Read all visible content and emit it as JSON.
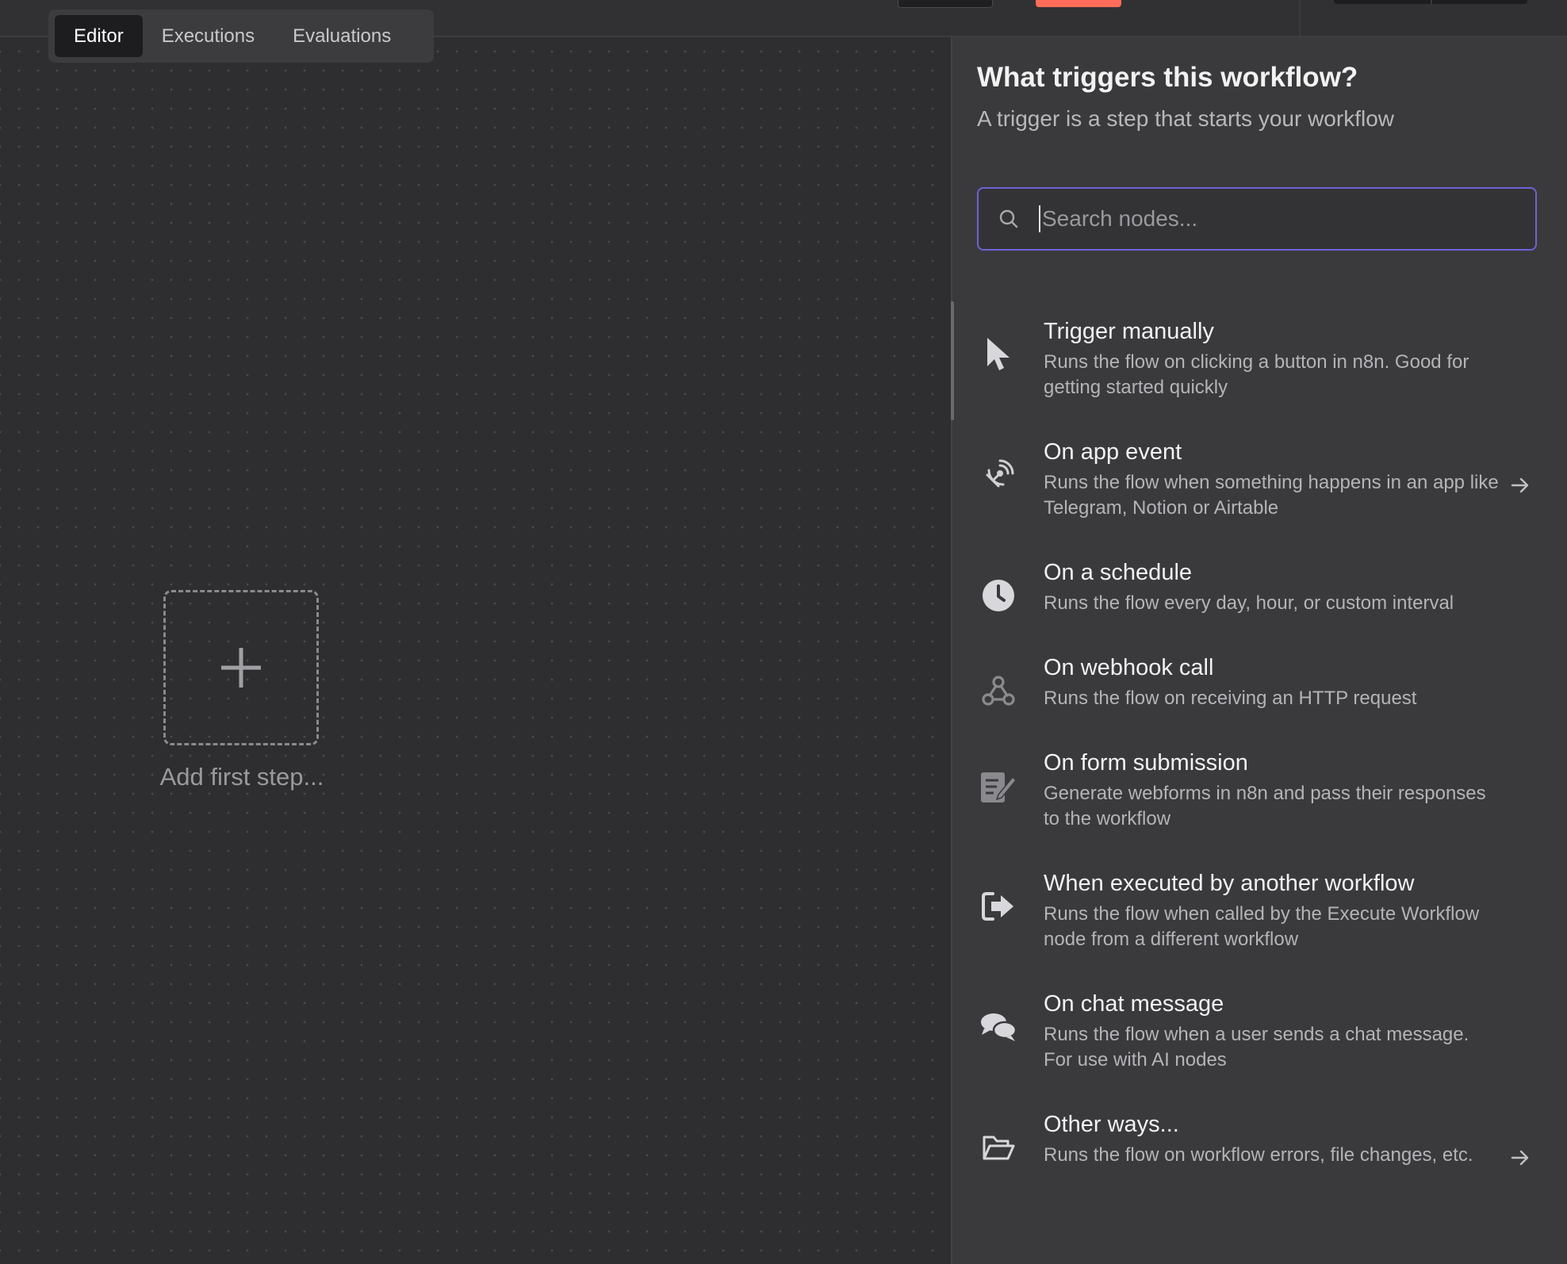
{
  "tabs": [
    {
      "label": "Editor",
      "active": true
    },
    {
      "label": "Executions",
      "active": false
    },
    {
      "label": "Evaluations",
      "active": false
    }
  ],
  "canvas": {
    "add_first_step_label": "Add first step..."
  },
  "panel": {
    "title": "What triggers this workflow?",
    "subtitle": "A trigger is a step that starts your workflow",
    "search_placeholder": "Search nodes...",
    "items": [
      {
        "title": "Trigger manually",
        "description": "Runs the flow on clicking a button in n8n. Good for getting started quickly",
        "icon": "cursor-icon",
        "has_arrow": false
      },
      {
        "title": "On app event",
        "description": "Runs the flow when something happens in an app like Telegram, Notion or Airtable",
        "icon": "satellite-dish-icon",
        "has_arrow": true
      },
      {
        "title": "On a schedule",
        "description": "Runs the flow every day, hour, or custom interval",
        "icon": "clock-icon",
        "has_arrow": false
      },
      {
        "title": "On webhook call",
        "description": "Runs the flow on receiving an HTTP request",
        "icon": "webhook-icon",
        "has_arrow": false
      },
      {
        "title": "On form submission",
        "description": "Generate webforms in n8n and pass their responses to the workflow",
        "icon": "form-icon",
        "has_arrow": false
      },
      {
        "title": "When executed by another workflow",
        "description": "Runs the flow when called by the Execute Workflow node from a different workflow",
        "icon": "sign-in-icon",
        "has_arrow": false
      },
      {
        "title": "On chat message",
        "description": "Runs the flow when a user sends a chat message. For use with AI nodes",
        "icon": "chat-icon",
        "has_arrow": false
      },
      {
        "title": "Other ways...",
        "description": "Runs the flow on workflow errors, file changes, etc.",
        "icon": "folder-open-icon",
        "has_arrow": true
      }
    ]
  },
  "colors": {
    "accent": "#ff6d5a",
    "focus_border": "#6d62d6",
    "canvas_bg": "#2e2e30",
    "panel_bg": "#3a3a3d"
  }
}
